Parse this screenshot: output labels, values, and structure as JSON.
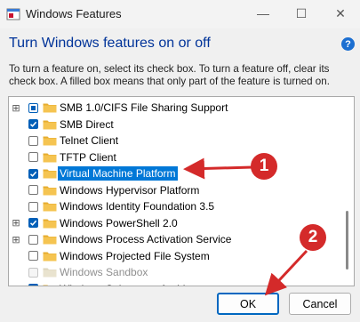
{
  "window": {
    "title": "Windows Features",
    "minimize_glyph": "—",
    "maximize_glyph": "☐",
    "close_glyph": "✕"
  },
  "heading": "Turn Windows features on or off",
  "help_glyph": "?",
  "description": "To turn a feature on, select its check box. To turn a feature off, clear its check box. A filled box means that only part of the feature is turned on.",
  "features": [
    {
      "label": "SMB 1.0/CIFS File Sharing Support",
      "state": "partial",
      "expandable": true
    },
    {
      "label": "SMB Direct",
      "state": "checked",
      "expandable": false
    },
    {
      "label": "Telnet Client",
      "state": "unchecked",
      "expandable": false
    },
    {
      "label": "TFTP Client",
      "state": "unchecked",
      "expandable": false
    },
    {
      "label": "Virtual Machine Platform",
      "state": "checked",
      "expandable": false,
      "selected": true
    },
    {
      "label": "Windows Hypervisor Platform",
      "state": "unchecked",
      "expandable": false
    },
    {
      "label": "Windows Identity Foundation 3.5",
      "state": "unchecked",
      "expandable": false
    },
    {
      "label": "Windows PowerShell 2.0",
      "state": "checked",
      "expandable": true
    },
    {
      "label": "Windows Process Activation Service",
      "state": "unchecked",
      "expandable": true
    },
    {
      "label": "Windows Projected File System",
      "state": "unchecked",
      "expandable": false
    },
    {
      "label": "Windows Sandbox",
      "state": "disabled",
      "expandable": false
    },
    {
      "label": "Windows Subsystem for Linux",
      "state": "checked",
      "expandable": false
    }
  ],
  "buttons": {
    "ok": "OK",
    "cancel": "Cancel"
  },
  "annotations": [
    {
      "number": "1"
    },
    {
      "number": "2"
    }
  ],
  "colors": {
    "accent": "#005fb8",
    "heading": "#003399",
    "annotation": "#d42a2a",
    "selection": "#0078d7"
  }
}
